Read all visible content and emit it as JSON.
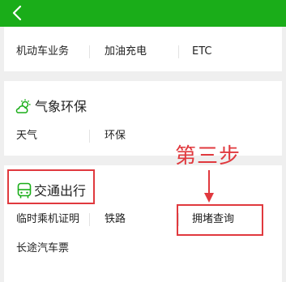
{
  "header": {
    "back_icon": "chevron-left-icon",
    "background": "#1aad19"
  },
  "vehicle_section": {
    "items": [
      {
        "label": "机动车业务"
      },
      {
        "label": "加油充电"
      },
      {
        "label": "ETC"
      }
    ]
  },
  "weather_section": {
    "title": "气象环保",
    "icon": "weather-sun-cloud-icon",
    "items": [
      {
        "label": "天气"
      },
      {
        "label": "环保"
      }
    ]
  },
  "transport_section": {
    "title": "交通出行",
    "icon": "bus-icon",
    "items": [
      {
        "label": "临时乘机证明"
      },
      {
        "label": "铁路"
      },
      {
        "label": "拥堵查询"
      },
      {
        "label": "长途汽车票"
      }
    ]
  },
  "annotation": {
    "text": "第三步",
    "color": "#e0393e"
  },
  "colors": {
    "accent": "#1aad19",
    "highlight": "#e0393e",
    "background": "#efefef"
  }
}
